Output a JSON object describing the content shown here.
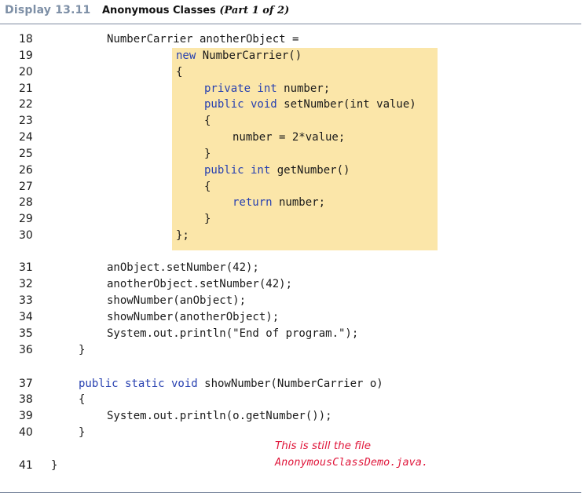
{
  "header": {
    "display": "Display 13.11",
    "title": "Anonymous Classes",
    "part": "(Part 1 of 2)"
  },
  "code_lines": [
    {
      "n": "18",
      "indent": 2,
      "text": "NumberCarrier anotherObject ="
    },
    {
      "n": "19",
      "indent": 4,
      "kw": "new",
      "text": " NumberCarrier()"
    },
    {
      "n": "20",
      "indent": 4,
      "text": "{"
    },
    {
      "n": "21",
      "indent": 5,
      "kw": "private int",
      "text": " number;"
    },
    {
      "n": "22",
      "indent": 5,
      "kw": "public void",
      "text": " setNumber(int value)"
    },
    {
      "n": "23",
      "indent": 5,
      "text": "{"
    },
    {
      "n": "24",
      "indent": 6,
      "text": "number = 2*value;"
    },
    {
      "n": "25",
      "indent": 5,
      "text": "}"
    },
    {
      "n": "26",
      "indent": 5,
      "kw": "public int",
      "text": " getNumber()"
    },
    {
      "n": "27",
      "indent": 5,
      "text": "{"
    },
    {
      "n": "28",
      "indent": 6,
      "kw": "return",
      "text": " number;"
    },
    {
      "n": "29",
      "indent": 5,
      "text": "}"
    },
    {
      "n": "30",
      "indent": 4,
      "text": "};"
    },
    {
      "n": "31",
      "indent": 2,
      "text": "anObject.setNumber(42);"
    },
    {
      "n": "32",
      "indent": 2,
      "text": "anotherObject.setNumber(42);"
    },
    {
      "n": "33",
      "indent": 2,
      "text": "showNumber(anObject);"
    },
    {
      "n": "34",
      "indent": 2,
      "text": "showNumber(anotherObject);"
    },
    {
      "n": "35",
      "indent": 2,
      "text": "System.out.println(\"End of program.\");"
    },
    {
      "n": "36",
      "indent": 1,
      "text": "}"
    },
    {
      "n": "37",
      "indent": 1,
      "kw": "public static void",
      "text": " showNumber(NumberCarrier o)"
    },
    {
      "n": "38",
      "indent": 1,
      "text": "{"
    },
    {
      "n": "39",
      "indent": 2,
      "text": "System.out.println(o.getNumber());"
    },
    {
      "n": "40",
      "indent": 1,
      "text": "}"
    },
    {
      "n": "41",
      "indent": 0,
      "text": "}"
    }
  ],
  "note": {
    "line1": "This is still the file",
    "file": "AnonymousClassDemo.java."
  },
  "colors": {
    "keyword": "#2740b0",
    "highlight": "#fbe6a9",
    "note": "#e0183c",
    "display_label": "#7d8fa6"
  }
}
